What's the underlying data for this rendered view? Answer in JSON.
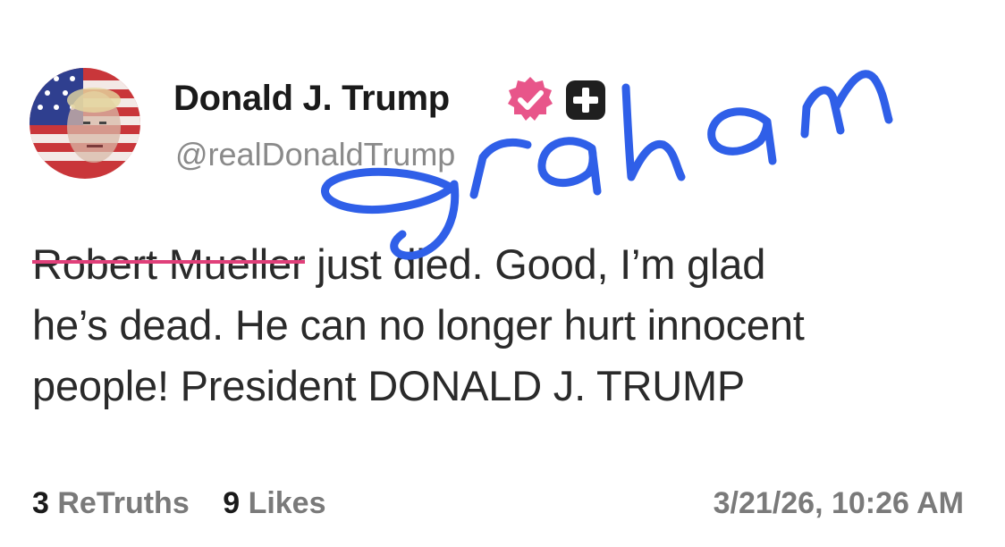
{
  "post": {
    "author": {
      "display_name": "Donald J. Trump",
      "handle": "@realDonaldTrump",
      "avatar_icon": "flag-portrait-avatar",
      "verified_icon": "verified-badge-icon",
      "plus_icon": "plus-badge-icon",
      "verified_color": "#e8558a"
    },
    "body": {
      "strikethrough_part": "Robert Mueller",
      "line1_rest": " just died. Good, I’m glad",
      "line2": "he’s dead. He can no longer hurt innocent",
      "line3": "people! President DONALD J. TRUMP"
    },
    "stats": {
      "retruths_count": "3",
      "retruths_label": "ReTruths",
      "likes_count": "9",
      "likes_label": "Likes"
    },
    "timestamp": "3/21/26, 10:26 AM"
  },
  "annotation": {
    "handwritten_word": "graham",
    "ink_color": "#2f5fe8",
    "strike_color": "#e0407a"
  }
}
